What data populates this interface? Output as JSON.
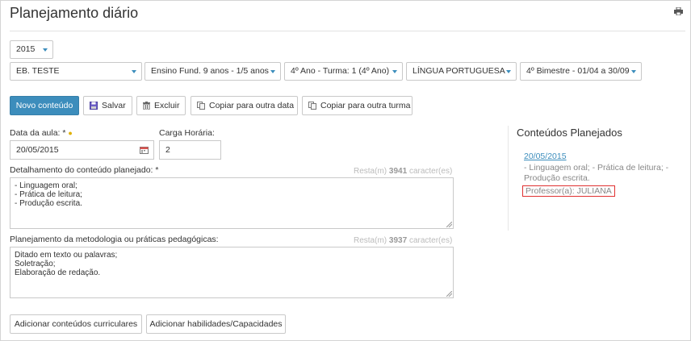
{
  "page": {
    "title": "Planejamento diário",
    "print_icon": "printer-icon"
  },
  "filters": {
    "year": "2015",
    "school": "EB. TESTE",
    "course": "Ensino Fund. 9 anos - 1/5 anos",
    "class": "4º Ano - Turma: 1 (4º Ano)",
    "subject": "LÍNGUA PORTUGUESA",
    "period": "4º Bimestre - 01/04 a 30/09"
  },
  "toolbar": {
    "new_label": "Novo conteúdo",
    "save_label": "Salvar",
    "delete_label": "Excluir",
    "copy_date_label": "Copiar para outra data",
    "copy_class_label": "Copiar para outra turma"
  },
  "form": {
    "date_label": "Data da aula: *",
    "date_value": "20/05/2015",
    "hours_label": "Carga Horária:",
    "hours_value": "2",
    "detail_label": "Detalhamento do conteúdo planejado: *",
    "detail_counter_prefix": "Resta(m)",
    "detail_counter_value": "3941",
    "detail_counter_suffix": "caracter(es)",
    "detail_lines": [
      "- Linguagem oral;",
      "- Prática de leitura;",
      "- Produção escrita."
    ],
    "method_label": "Planejamento da metodologia ou práticas pedagógicas:",
    "method_counter_prefix": "Resta(m)",
    "method_counter_value": "3937",
    "method_counter_suffix": "caracter(es)",
    "method_lines": [
      "Ditado em texto ou palavras;",
      "Soletração;",
      "Elaboração de redação."
    ]
  },
  "bottom": {
    "add_contents_label": "Adicionar conteúdos curriculares",
    "add_skills_label": "Adicionar habilidades/Capacidades"
  },
  "sidebar": {
    "title": "Conteúdos Planejados",
    "date": "20/05/2015",
    "text": "- Linguagem oral; - Prática de leitura; - Produção escrita.",
    "teacher": "Professor(a): JULIANA"
  },
  "colors": {
    "primary": "#3c8dbc",
    "highlight_border": "#e03030"
  }
}
